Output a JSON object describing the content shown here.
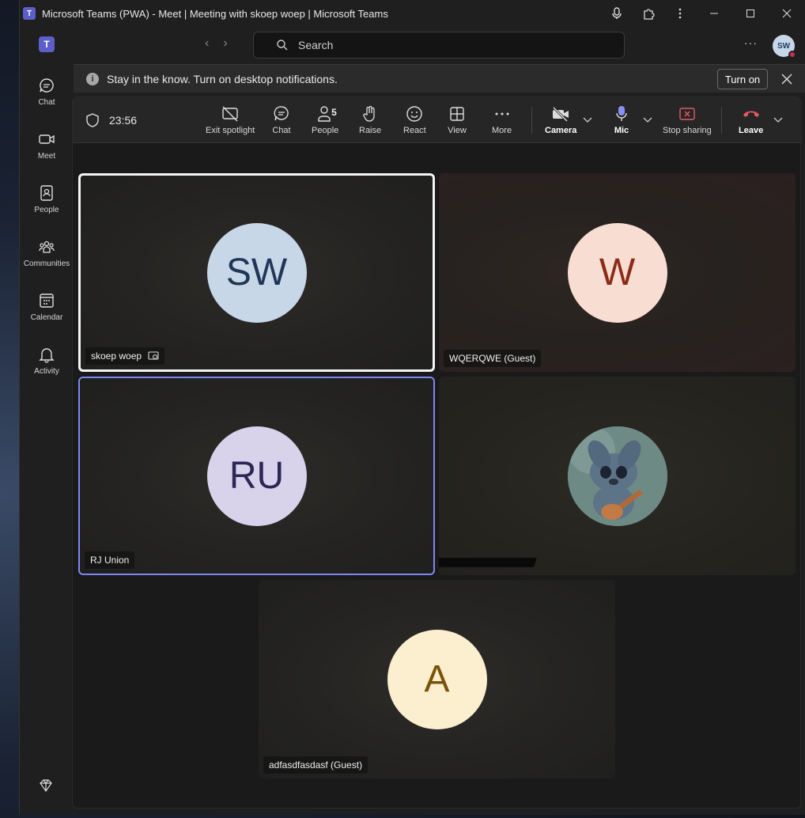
{
  "titlebar": {
    "title": "Microsoft Teams (PWA) - Meet | Meeting with skoep woep | Microsoft Teams",
    "logo": "T"
  },
  "rail": {
    "logo": "T",
    "items": [
      {
        "label": "Chat",
        "icon": "chat-icon"
      },
      {
        "label": "Meet",
        "icon": "video-icon"
      },
      {
        "label": "People",
        "icon": "contact-card-icon"
      },
      {
        "label": "Communities",
        "icon": "communities-icon"
      },
      {
        "label": "Calendar",
        "icon": "calendar-icon"
      },
      {
        "label": "Activity",
        "icon": "bell-icon"
      }
    ]
  },
  "search": {
    "placeholder": "Search"
  },
  "user": {
    "initials": "SW"
  },
  "banner": {
    "text": "Stay in the know. Turn on desktop notifications.",
    "button": "Turn on"
  },
  "meeting": {
    "timer": "23:56",
    "people_count": "5",
    "tools": {
      "exit_spotlight": "Exit spotlight",
      "chat": "Chat",
      "people": "People",
      "raise": "Raise",
      "react": "React",
      "view": "View",
      "more": "More",
      "camera": "Camera",
      "mic": "Mic",
      "stop_sharing": "Stop sharing",
      "leave": "Leave"
    },
    "accent": "#7f85f5",
    "leave_color": "#e35a62",
    "stop_share_color": "#e35a62"
  },
  "participants": [
    {
      "name": "skoep woep",
      "initials": "SW",
      "bg": "#c8d7e8",
      "fg": "#1f3656",
      "pinned": true
    },
    {
      "name": "WQERQWE (Guest)",
      "initials": "W",
      "bg": "#f8ddd3",
      "fg": "#8a2b18"
    },
    {
      "name": "RJ Union",
      "initials": "RU",
      "bg": "#d8d3ea",
      "fg": "#2c2757",
      "active": true
    },
    {
      "name": "",
      "initials": "",
      "picture": "stitch-ukulele",
      "redacted": true
    },
    {
      "name": "adfasdfasdasf (Guest)",
      "initials": "A",
      "bg": "#fcefcf",
      "fg": "#7a5206"
    }
  ]
}
